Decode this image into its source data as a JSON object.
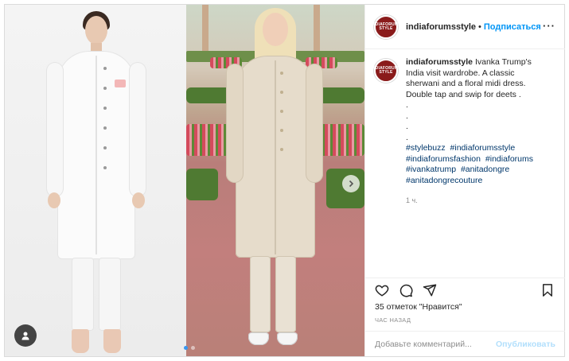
{
  "header": {
    "username": "indiaforumsstyle",
    "separator": "•",
    "follow_label": "Подписаться",
    "more_label": "···",
    "avatar_text": "INDIAFORUMS STYLE"
  },
  "caption": {
    "username": "indiaforumsstyle",
    "text": "Ivanka Trump's India visit wardrobe. A classic sherwani and a floral midi dress. Double tap and swip for deets .",
    "dots": [
      ".",
      ".",
      ".",
      "."
    ],
    "hashtags": [
      "#stylebuzz",
      "#indiaforumsstyle",
      "#indiaforumsfashion",
      "#indiaforums",
      "#ivankatrump",
      "#anitadongre",
      "#anitadongrecouture"
    ],
    "time": "1 ч."
  },
  "actions": {
    "like_icon": "heart-icon",
    "comment_icon": "comment-icon",
    "share_icon": "share-icon",
    "save_icon": "bookmark-icon"
  },
  "likes": {
    "text": "35 отметок \"Нравится\""
  },
  "timestamp": {
    "text": "ЧАС НАЗАД"
  },
  "comment": {
    "placeholder": "Добавьте комментарий...",
    "publish_label": "Опубликовать"
  },
  "media": {
    "slide_index": 1,
    "slide_count": 3
  },
  "colors": {
    "follow": "#0095f6",
    "hashtag": "#00376b",
    "publish_disabled": "#b2dffc",
    "dot_active": "#3897f0"
  }
}
